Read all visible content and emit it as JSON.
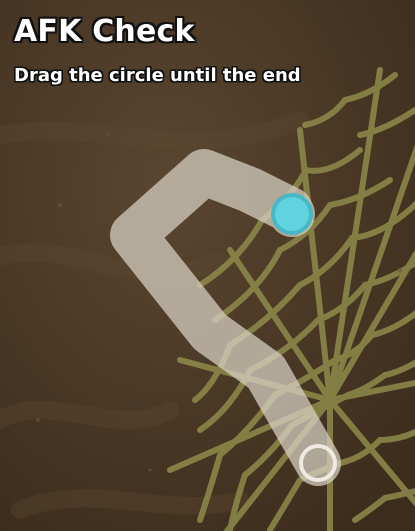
{
  "afk_check": {
    "title": "AFK Check",
    "instruction": "Drag the circle until the end"
  },
  "drag_progress": 0,
  "colors": {
    "background": "#4a3925",
    "path": "#d8d2c5",
    "handle_fill": "#5fd3df",
    "handle_border": "#48b8c6",
    "web": "#8e8b4a",
    "title_text": "#ffffff",
    "title_outline": "#111111"
  },
  "icons": {
    "drag_handle": "circle-handle",
    "end_target": "ring-target",
    "decor": "spider-web"
  }
}
